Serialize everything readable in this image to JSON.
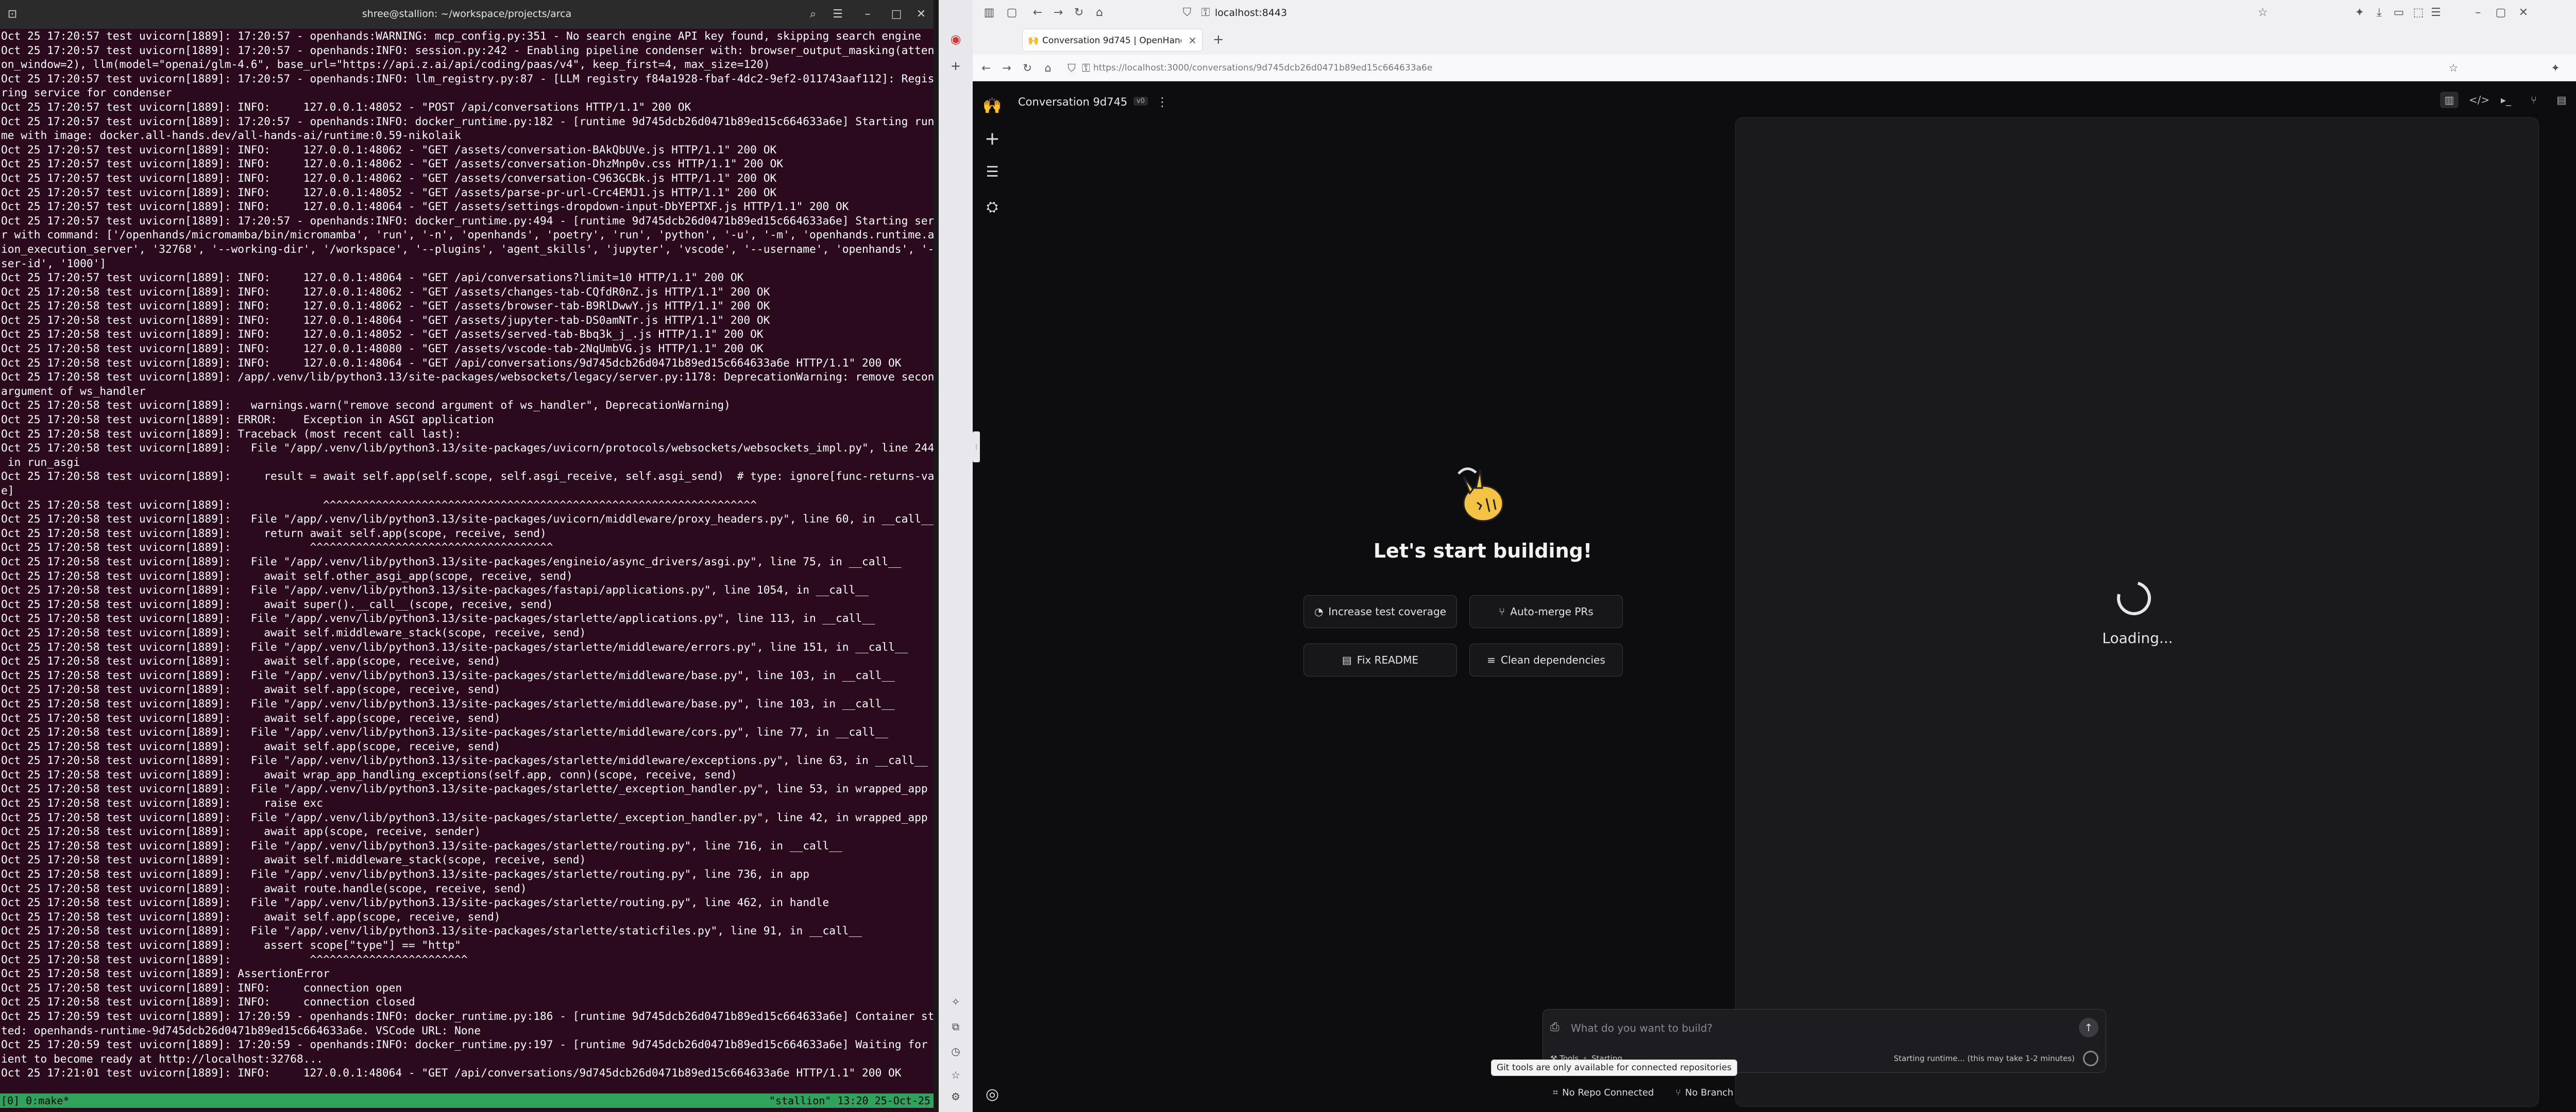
{
  "terminal": {
    "title": "shree@stallion: ~/workspace/projects/arca",
    "lines": [
      "Oct 25 17:20:57 test uvicorn[1889]: 17:20:57 - openhands:WARNING: mcp_config.py:351 - No search engine API key found, skipping search engine",
      "Oct 25 17:20:57 test uvicorn[1889]: 17:20:57 - openhands:INFO: session.py:242 - Enabling pipeline condenser with: browser_output_masking(attenti",
      "on_window=2), llm(model=\"openai/glm-4.6\", base_url=\"https://api.z.ai/api/coding/paas/v4\", keep_first=4, max_size=120)",
      "Oct 25 17:20:57 test uvicorn[1889]: 17:20:57 - openhands:INFO: llm_registry.py:87 - [LLM registry f84a1928-fbaf-4dc2-9ef2-011743aaf112]: Registe",
      "ring service for condenser",
      "Oct 25 17:20:57 test uvicorn[1889]: INFO:     127.0.0.1:48052 - \"POST /api/conversations HTTP/1.1\" 200 OK",
      "Oct 25 17:20:57 test uvicorn[1889]: 17:20:57 - openhands:INFO: docker_runtime.py:182 - [runtime 9d745dcb26d0471b89ed15c664633a6e] Starting runti",
      "me with image: docker.all-hands.dev/all-hands-ai/runtime:0.59-nikolaik",
      "Oct 25 17:20:57 test uvicorn[1889]: INFO:     127.0.0.1:48062 - \"GET /assets/conversation-BAkQbUVe.js HTTP/1.1\" 200 OK",
      "Oct 25 17:20:57 test uvicorn[1889]: INFO:     127.0.0.1:48062 - \"GET /assets/conversation-DhzMnp0v.css HTTP/1.1\" 200 OK",
      "Oct 25 17:20:57 test uvicorn[1889]: INFO:     127.0.0.1:48062 - \"GET /assets/conversation-C963GCBk.js HTTP/1.1\" 200 OK",
      "Oct 25 17:20:57 test uvicorn[1889]: INFO:     127.0.0.1:48052 - \"GET /assets/parse-pr-url-Crc4EMJ1.js HTTP/1.1\" 200 OK",
      "Oct 25 17:20:57 test uvicorn[1889]: INFO:     127.0.0.1:48064 - \"GET /assets/settings-dropdown-input-DbYEPTXF.js HTTP/1.1\" 200 OK",
      "Oct 25 17:20:57 test uvicorn[1889]: 17:20:57 - openhands:INFO: docker_runtime.py:494 - [runtime 9d745dcb26d0471b89ed15c664633a6e] Starting serve",
      "r with command: ['/openhands/micromamba/bin/micromamba', 'run', '-n', 'openhands', 'poetry', 'run', 'python', '-u', '-m', 'openhands.runtime.act",
      "ion_execution_server', '32768', '--working-dir', '/workspace', '--plugins', 'agent_skills', 'jupyter', 'vscode', '--username', 'openhands', '--u",
      "ser-id', '1000']",
      "Oct 25 17:20:57 test uvicorn[1889]: INFO:     127.0.0.1:48064 - \"GET /api/conversations?limit=10 HTTP/1.1\" 200 OK",
      "Oct 25 17:20:58 test uvicorn[1889]: INFO:     127.0.0.1:48062 - \"GET /assets/changes-tab-CQfdR0nZ.js HTTP/1.1\" 200 OK",
      "Oct 25 17:20:58 test uvicorn[1889]: INFO:     127.0.0.1:48062 - \"GET /assets/browser-tab-B9RlDwwY.js HTTP/1.1\" 200 OK",
      "Oct 25 17:20:58 test uvicorn[1889]: INFO:     127.0.0.1:48064 - \"GET /assets/jupyter-tab-DS0amNTr.js HTTP/1.1\" 200 OK",
      "Oct 25 17:20:58 test uvicorn[1889]: INFO:     127.0.0.1:48052 - \"GET /assets/served-tab-Bbq3k_j_.js HTTP/1.1\" 200 OK",
      "Oct 25 17:20:58 test uvicorn[1889]: INFO:     127.0.0.1:48080 - \"GET /assets/vscode-tab-2NqUmbVG.js HTTP/1.1\" 200 OK",
      "Oct 25 17:20:58 test uvicorn[1889]: INFO:     127.0.0.1:48064 - \"GET /api/conversations/9d745dcb26d0471b89ed15c664633a6e HTTP/1.1\" 200 OK",
      "Oct 25 17:20:58 test uvicorn[1889]: /app/.venv/lib/python3.13/site-packages/websockets/legacy/server.py:1178: DeprecationWarning: remove second",
      "argument of ws_handler",
      "Oct 25 17:20:58 test uvicorn[1889]:   warnings.warn(\"remove second argument of ws_handler\", DeprecationWarning)",
      "Oct 25 17:20:58 test uvicorn[1889]: ERROR:    Exception in ASGI application",
      "Oct 25 17:20:58 test uvicorn[1889]: Traceback (most recent call last):",
      "Oct 25 17:20:58 test uvicorn[1889]:   File \"/app/.venv/lib/python3.13/site-packages/uvicorn/protocols/websockets/websockets_impl.py\", line 244,",
      " in run_asgi",
      "Oct 25 17:20:58 test uvicorn[1889]:     result = await self.app(self.scope, self.asgi_receive, self.asgi_send)  # type: ignore[func-returns-valu",
      "e]",
      "Oct 25 17:20:58 test uvicorn[1889]:              ^^^^^^^^^^^^^^^^^^^^^^^^^^^^^^^^^^^^^^^^^^^^^^^^^^^^^^^^^^^^^^^^^^",
      "Oct 25 17:20:58 test uvicorn[1889]:   File \"/app/.venv/lib/python3.13/site-packages/uvicorn/middleware/proxy_headers.py\", line 60, in __call__",
      "Oct 25 17:20:58 test uvicorn[1889]:     return await self.app(scope, receive, send)",
      "Oct 25 17:20:58 test uvicorn[1889]:            ^^^^^^^^^^^^^^^^^^^^^^^^^^^^^^^^^^^^^",
      "Oct 25 17:20:58 test uvicorn[1889]:   File \"/app/.venv/lib/python3.13/site-packages/engineio/async_drivers/asgi.py\", line 75, in __call__",
      "Oct 25 17:20:58 test uvicorn[1889]:     await self.other_asgi_app(scope, receive, send)",
      "Oct 25 17:20:58 test uvicorn[1889]:   File \"/app/.venv/lib/python3.13/site-packages/fastapi/applications.py\", line 1054, in __call__",
      "Oct 25 17:20:58 test uvicorn[1889]:     await super().__call__(scope, receive, send)",
      "Oct 25 17:20:58 test uvicorn[1889]:   File \"/app/.venv/lib/python3.13/site-packages/starlette/applications.py\", line 113, in __call__",
      "Oct 25 17:20:58 test uvicorn[1889]:     await self.middleware_stack(scope, receive, send)",
      "Oct 25 17:20:58 test uvicorn[1889]:   File \"/app/.venv/lib/python3.13/site-packages/starlette/middleware/errors.py\", line 151, in __call__",
      "Oct 25 17:20:58 test uvicorn[1889]:     await self.app(scope, receive, send)",
      "Oct 25 17:20:58 test uvicorn[1889]:   File \"/app/.venv/lib/python3.13/site-packages/starlette/middleware/base.py\", line 103, in __call__",
      "Oct 25 17:20:58 test uvicorn[1889]:     await self.app(scope, receive, send)",
      "Oct 25 17:20:58 test uvicorn[1889]:   File \"/app/.venv/lib/python3.13/site-packages/starlette/middleware/base.py\", line 103, in __call__",
      "Oct 25 17:20:58 test uvicorn[1889]:     await self.app(scope, receive, send)",
      "Oct 25 17:20:58 test uvicorn[1889]:   File \"/app/.venv/lib/python3.13/site-packages/starlette/middleware/cors.py\", line 77, in __call__",
      "Oct 25 17:20:58 test uvicorn[1889]:     await self.app(scope, receive, send)",
      "Oct 25 17:20:58 test uvicorn[1889]:   File \"/app/.venv/lib/python3.13/site-packages/starlette/middleware/exceptions.py\", line 63, in __call__",
      "Oct 25 17:20:58 test uvicorn[1889]:     await wrap_app_handling_exceptions(self.app, conn)(scope, receive, send)",
      "Oct 25 17:20:58 test uvicorn[1889]:   File \"/app/.venv/lib/python3.13/site-packages/starlette/_exception_handler.py\", line 53, in wrapped_app",
      "Oct 25 17:20:58 test uvicorn[1889]:     raise exc",
      "Oct 25 17:20:58 test uvicorn[1889]:   File \"/app/.venv/lib/python3.13/site-packages/starlette/_exception_handler.py\", line 42, in wrapped_app",
      "Oct 25 17:20:58 test uvicorn[1889]:     await app(scope, receive, sender)",
      "Oct 25 17:20:58 test uvicorn[1889]:   File \"/app/.venv/lib/python3.13/site-packages/starlette/routing.py\", line 716, in __call__",
      "Oct 25 17:20:58 test uvicorn[1889]:     await self.middleware_stack(scope, receive, send)",
      "Oct 25 17:20:58 test uvicorn[1889]:   File \"/app/.venv/lib/python3.13/site-packages/starlette/routing.py\", line 736, in app",
      "Oct 25 17:20:58 test uvicorn[1889]:     await route.handle(scope, receive, send)",
      "Oct 25 17:20:58 test uvicorn[1889]:   File \"/app/.venv/lib/python3.13/site-packages/starlette/routing.py\", line 462, in handle",
      "Oct 25 17:20:58 test uvicorn[1889]:     await self.app(scope, receive, send)",
      "Oct 25 17:20:58 test uvicorn[1889]:   File \"/app/.venv/lib/python3.13/site-packages/starlette/staticfiles.py\", line 91, in __call__",
      "Oct 25 17:20:58 test uvicorn[1889]:     assert scope[\"type\"] == \"http\"",
      "Oct 25 17:20:58 test uvicorn[1889]:            ^^^^^^^^^^^^^^^^^^^^^^^^",
      "Oct 25 17:20:58 test uvicorn[1889]: AssertionError",
      "Oct 25 17:20:58 test uvicorn[1889]: INFO:     connection open",
      "Oct 25 17:20:58 test uvicorn[1889]: INFO:     connection closed",
      "Oct 25 17:20:59 test uvicorn[1889]: 17:20:59 - openhands:INFO: docker_runtime.py:186 - [runtime 9d745dcb26d0471b89ed15c664633a6e] Container star",
      "ted: openhands-runtime-9d745dcb26d0471b89ed15c664633a6e. VSCode URL: None",
      "Oct 25 17:20:59 test uvicorn[1889]: 17:20:59 - openhands:INFO: docker_runtime.py:197 - [runtime 9d745dcb26d0471b89ed15c664633a6e] Waiting for cl",
      "ient to become ready at http://localhost:32768...",
      "Oct 25 17:21:01 test uvicorn[1889]: INFO:     127.0.0.1:48064 - \"GET /api/conversations/9d745dcb26d0471b89ed15c664633a6e HTTP/1.1\" 200 OK",
      ""
    ],
    "status_left": "[0] 0:make*",
    "status_right": "\"stallion\" 13:20 25-Oct-25"
  },
  "browser": {
    "window_url": "localhost:8443",
    "tab_title": "Conversation 9d745 | OpenHands",
    "address": "https://localhost:3000/conversations/9d745dcb26d0471b89ed15c664633a6e"
  },
  "app": {
    "conversation_title": "Conversation 9d745",
    "conversation_badge": "v0",
    "hero_title": "Let's start building!",
    "suggestions": [
      {
        "label": "Increase test coverage",
        "icon": "gauge-icon",
        "glyph": "◔"
      },
      {
        "label": "Auto-merge PRs",
        "icon": "git-merge-icon",
        "glyph": "⑂"
      },
      {
        "label": "Fix README",
        "icon": "document-icon",
        "glyph": "▤"
      },
      {
        "label": "Clean dependencies",
        "icon": "list-icon",
        "glyph": "≡"
      }
    ],
    "loading_text": "Loading...",
    "chat_placeholder": "What do you want to build?",
    "tools_label": "Tools",
    "tools_status": "Starting",
    "runtime_status": "Starting runtime... (this may take 1-2 minutes)",
    "tooltip": "Git tools are only available for connected repositories",
    "repo_label": "No Repo Connected",
    "branch_label": "No Branch"
  },
  "colors": {
    "terminal_bg": "#2c0a1e",
    "tmux_status": "#2fa35c",
    "app_bg": "#0d0d0f"
  }
}
